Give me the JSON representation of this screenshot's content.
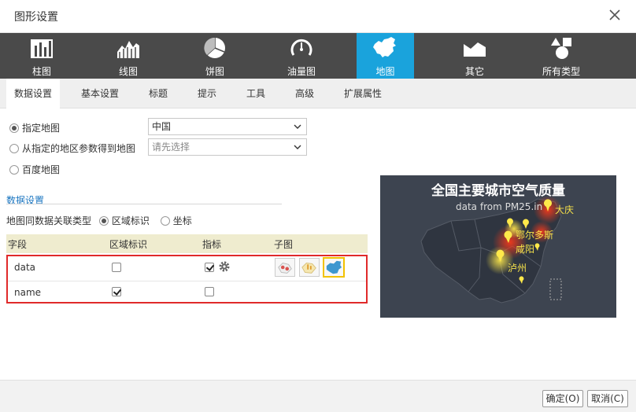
{
  "dialog": {
    "title": "图形设置"
  },
  "chart_types": [
    {
      "label": "柱图",
      "icon": "bar-chart-icon"
    },
    {
      "label": "线图",
      "icon": "line-chart-icon"
    },
    {
      "label": "饼图",
      "icon": "pie-chart-icon"
    },
    {
      "label": "油量图",
      "icon": "gauge-icon"
    },
    {
      "label": "地图",
      "icon": "china-map-icon",
      "active": true
    },
    {
      "label": "其它",
      "icon": "other-chart-icon"
    },
    {
      "label": "所有类型",
      "icon": "all-types-icon"
    }
  ],
  "tabs": [
    "数据设置",
    "基本设置",
    "标题",
    "提示",
    "工具",
    "高级",
    "扩展属性"
  ],
  "map_source": {
    "specified_label": "指定地图",
    "specified_value": "中国",
    "param_label": "从指定的地区参数得到地图",
    "param_placeholder": "请先选择",
    "baidu_label": "百度地图"
  },
  "data_settings": {
    "section_title": "数据设置",
    "assoc_label": "地图同数据关联类型",
    "assoc_options": [
      "区域标识",
      "坐标"
    ],
    "columns": [
      "字段",
      "区域标识",
      "指标",
      "子图"
    ],
    "rows": [
      {
        "field": "data",
        "region_id": false,
        "indicator": true
      },
      {
        "field": "name",
        "region_id": true,
        "indicator": false
      }
    ]
  },
  "preview": {
    "title": "全国主要城市空气质量",
    "subtitle": "data from PM25.in",
    "cities": [
      "大庆",
      "鄂尔多斯",
      "咸阳",
      "泸州"
    ]
  },
  "buttons": {
    "ok": "确定(O)",
    "cancel": "取消(C)"
  },
  "colors": {
    "accent": "#1aa3dc",
    "toolbar": "#4a4a4a",
    "highlight": "#e02a2a",
    "city_label": "#f6e24a"
  }
}
